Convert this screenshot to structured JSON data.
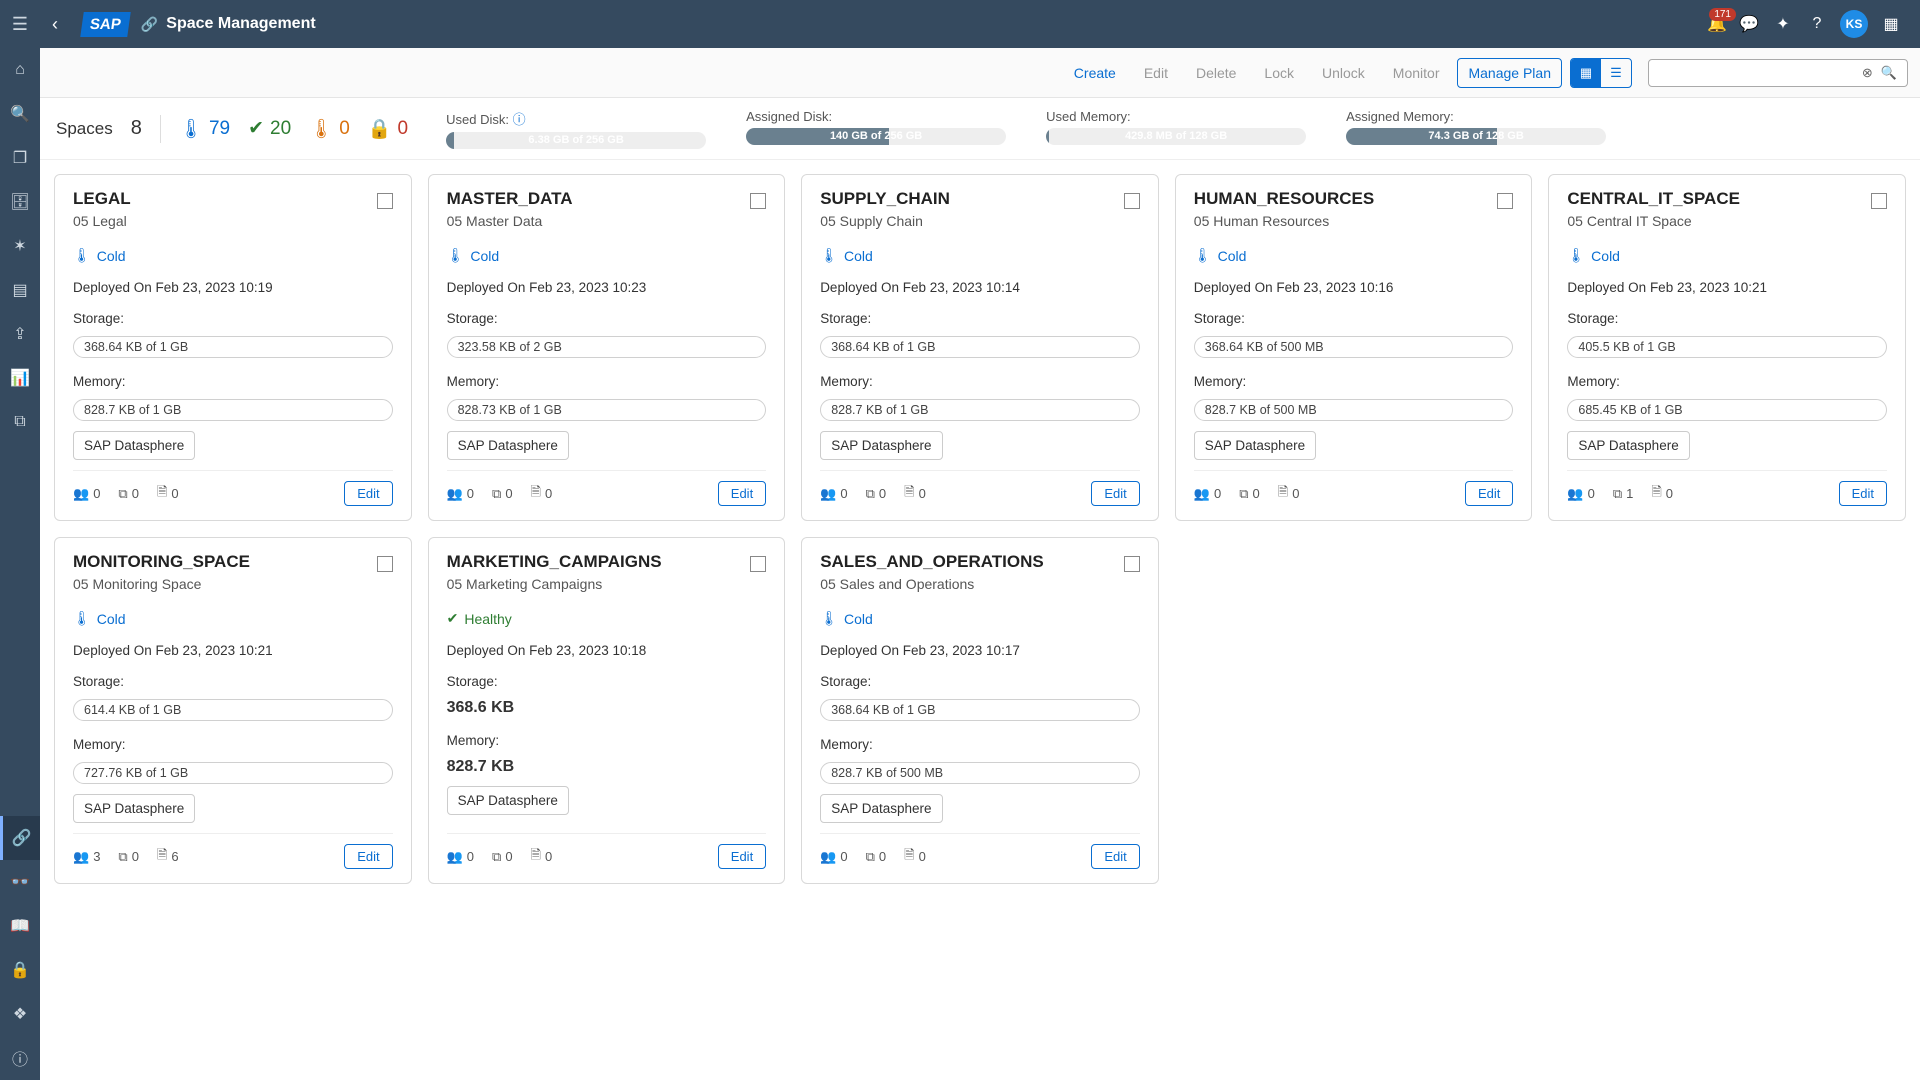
{
  "header": {
    "logo": "SAP",
    "title": "Space Management",
    "notifications": "171",
    "avatar": "KS"
  },
  "actions": {
    "create": "Create",
    "edit": "Edit",
    "delete": "Delete",
    "lock": "Lock",
    "unlock": "Unlock",
    "monitor": "Monitor",
    "manage_plan": "Manage Plan"
  },
  "summary": {
    "spaces_label": "Spaces",
    "spaces_count": "8",
    "cold": "79",
    "healthy": "20",
    "hot": "0",
    "locked": "0"
  },
  "meters": {
    "used_disk_label": "Used Disk:",
    "used_disk_text": "6.38 GB of 256 GB",
    "used_disk_pct": 3,
    "assigned_disk_label": "Assigned Disk:",
    "assigned_disk_text": "140 GB of 256 GB",
    "assigned_disk_pct": 55,
    "used_memory_label": "Used Memory:",
    "used_memory_text": "429.8 MB of 128 GB",
    "used_memory_pct": 1,
    "assigned_memory_label": "Assigned Memory:",
    "assigned_memory_text": "74.3 GB of 128 GB",
    "assigned_memory_pct": 58
  },
  "labels": {
    "storage": "Storage:",
    "memory": "Memory:",
    "deployed": "Deployed On",
    "cold": "Cold",
    "healthy": "Healthy",
    "chip": "SAP Datasphere",
    "edit": "Edit"
  },
  "cards": [
    {
      "name": "LEGAL",
      "sub": "05 Legal",
      "status": "cold",
      "deployed": "Feb 23, 2023 10:19",
      "storage": "368.64 KB of 1 GB",
      "memory": "828.7 KB of 1 GB",
      "m": "0",
      "t": "0",
      "f": "0",
      "big": false
    },
    {
      "name": "MASTER_DATA",
      "sub": "05 Master Data",
      "status": "cold",
      "deployed": "Feb 23, 2023 10:23",
      "storage": "323.58 KB of 2 GB",
      "memory": "828.73 KB of 1 GB",
      "m": "0",
      "t": "0",
      "f": "0",
      "big": false
    },
    {
      "name": "SUPPLY_CHAIN",
      "sub": "05 Supply Chain",
      "status": "cold",
      "deployed": "Feb 23, 2023 10:14",
      "storage": "368.64 KB of 1 GB",
      "memory": "828.7 KB of 1 GB",
      "m": "0",
      "t": "0",
      "f": "0",
      "big": false
    },
    {
      "name": "HUMAN_RESOURCES",
      "sub": "05 Human Resources",
      "status": "cold",
      "deployed": "Feb 23, 2023 10:16",
      "storage": "368.64 KB of 500 MB",
      "memory": "828.7 KB of 500 MB",
      "m": "0",
      "t": "0",
      "f": "0",
      "big": false
    },
    {
      "name": "CENTRAL_IT_SPACE",
      "sub": "05 Central IT Space",
      "status": "cold",
      "deployed": "Feb 23, 2023 10:21",
      "storage": "405.5 KB of 1 GB",
      "memory": "685.45 KB of 1 GB",
      "m": "0",
      "t": "1",
      "f": "0",
      "big": false
    },
    {
      "name": "MONITORING_SPACE",
      "sub": "05 Monitoring Space",
      "status": "cold",
      "deployed": "Feb 23, 2023 10:21",
      "storage": "614.4 KB of 1 GB",
      "memory": "727.76 KB of 1 GB",
      "m": "3",
      "t": "0",
      "f": "6",
      "big": false
    },
    {
      "name": "MARKETING_CAMPAIGNS",
      "sub": "05 Marketing Campaigns",
      "status": "healthy",
      "deployed": "Feb 23, 2023 10:18",
      "storage": "368.6 KB",
      "memory": "828.7 KB",
      "m": "0",
      "t": "0",
      "f": "0",
      "big": true
    },
    {
      "name": "SALES_AND_OPERATIONS",
      "sub": "05 Sales and Operations",
      "status": "cold",
      "deployed": "Feb 23, 2023 10:17",
      "storage": "368.64 KB of 1 GB",
      "memory": "828.7 KB of 500 MB",
      "m": "0",
      "t": "0",
      "f": "0",
      "big": false
    }
  ]
}
